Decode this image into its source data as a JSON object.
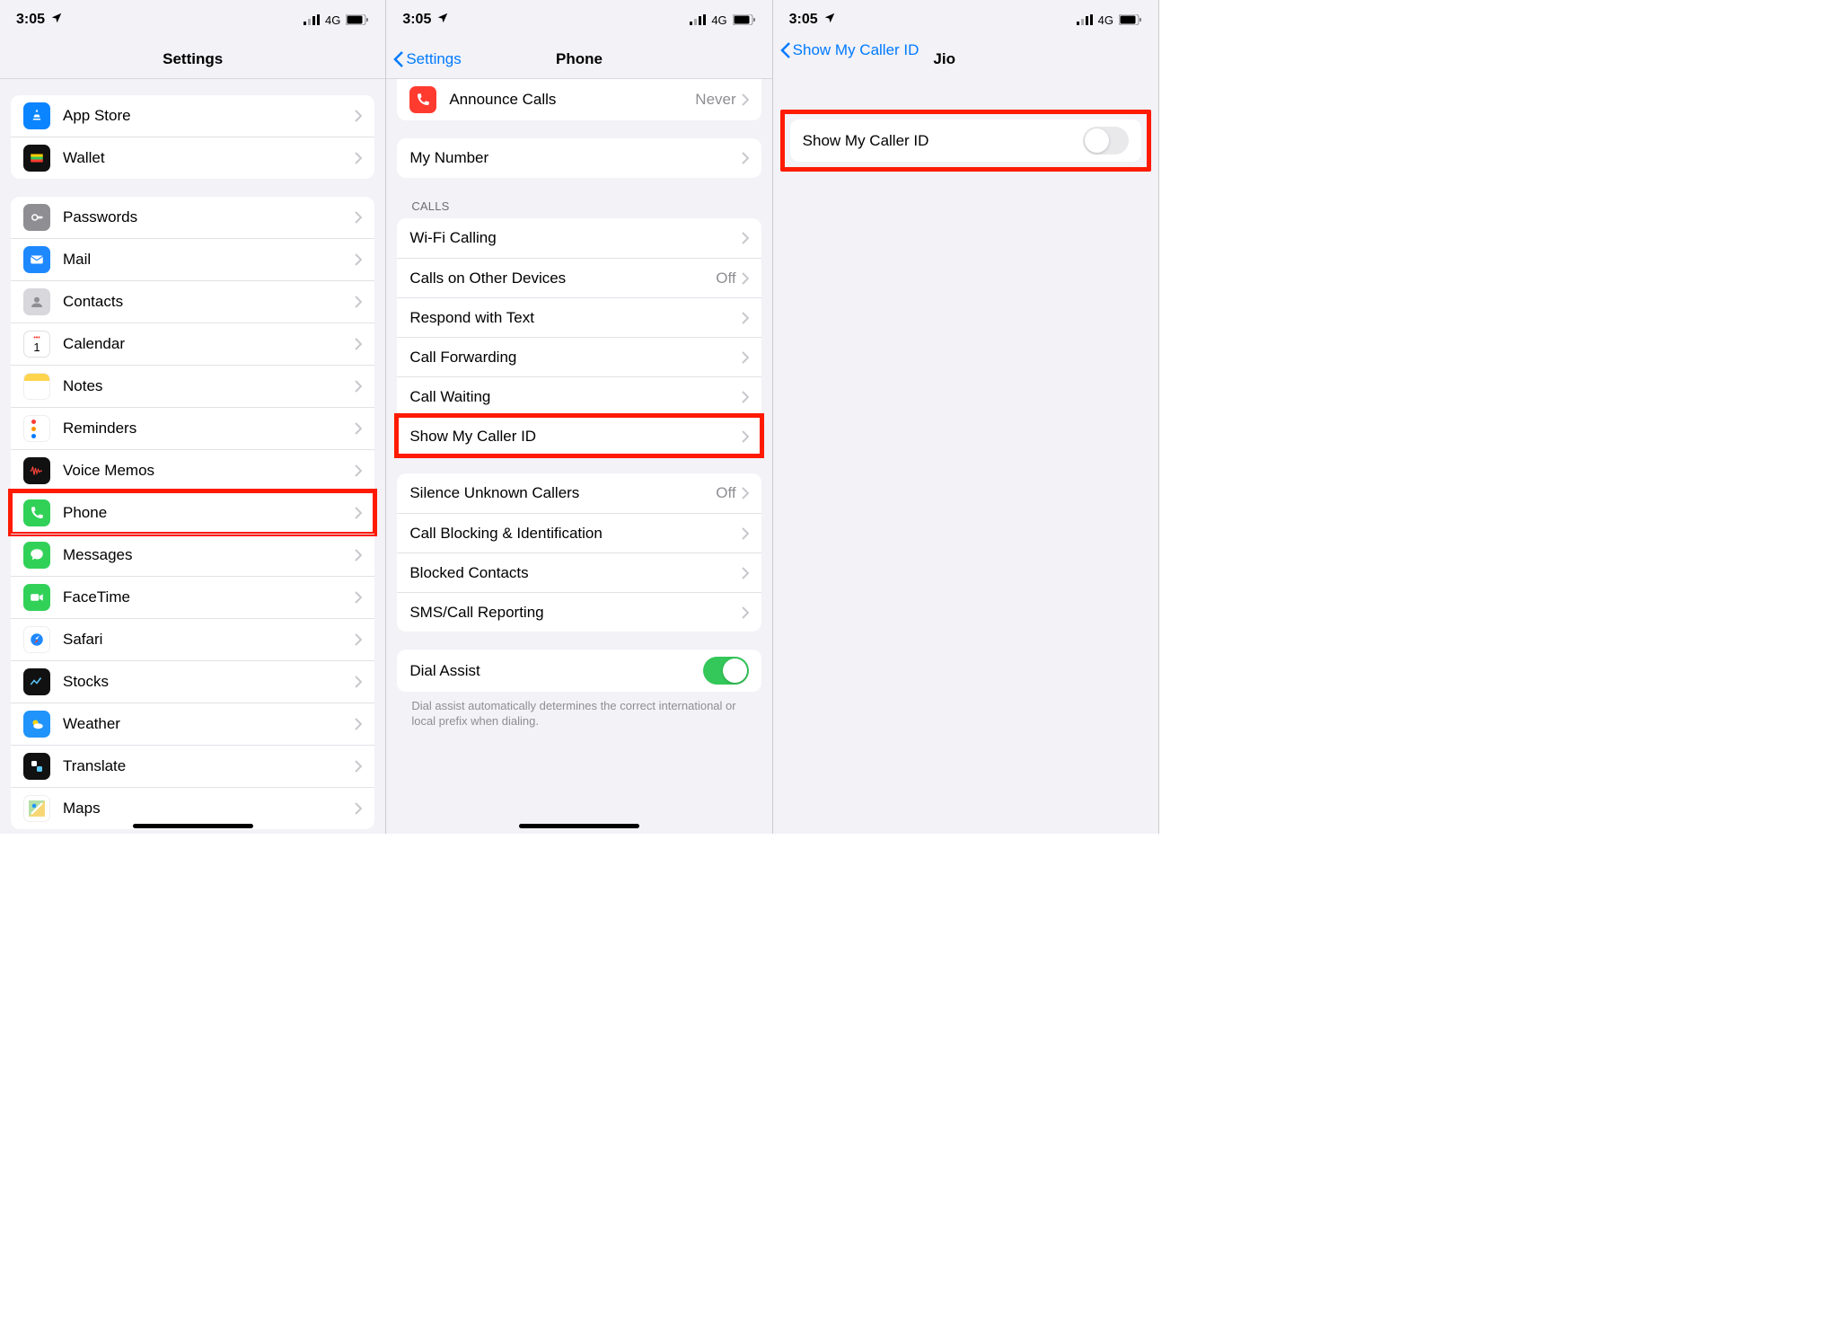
{
  "status": {
    "time": "3:05",
    "network": "4G"
  },
  "screen1": {
    "title": "Settings",
    "group1": [
      {
        "id": "app-store",
        "label": "App Store"
      },
      {
        "id": "wallet",
        "label": "Wallet"
      }
    ],
    "group2": [
      {
        "id": "passwords",
        "label": "Passwords"
      },
      {
        "id": "mail",
        "label": "Mail"
      },
      {
        "id": "contacts",
        "label": "Contacts"
      },
      {
        "id": "calendar",
        "label": "Calendar"
      },
      {
        "id": "notes",
        "label": "Notes"
      },
      {
        "id": "reminders",
        "label": "Reminders"
      },
      {
        "id": "voice-memos",
        "label": "Voice Memos"
      },
      {
        "id": "phone",
        "label": "Phone",
        "highlight": true
      },
      {
        "id": "messages",
        "label": "Messages"
      },
      {
        "id": "facetime",
        "label": "FaceTime"
      },
      {
        "id": "safari",
        "label": "Safari"
      },
      {
        "id": "stocks",
        "label": "Stocks"
      },
      {
        "id": "weather",
        "label": "Weather"
      },
      {
        "id": "translate",
        "label": "Translate"
      },
      {
        "id": "maps",
        "label": "Maps"
      }
    ]
  },
  "screen2": {
    "back": "Settings",
    "title": "Phone",
    "announce": {
      "label": "Announce Calls",
      "value": "Never"
    },
    "mynumber": {
      "label": "My Number"
    },
    "calls_header": "CALLS",
    "calls": [
      {
        "id": "wifi-calling",
        "label": "Wi-Fi Calling"
      },
      {
        "id": "other-devices",
        "label": "Calls on Other Devices",
        "value": "Off"
      },
      {
        "id": "respond-text",
        "label": "Respond with Text"
      },
      {
        "id": "call-forwarding",
        "label": "Call Forwarding"
      },
      {
        "id": "call-waiting",
        "label": "Call Waiting"
      },
      {
        "id": "show-caller-id",
        "label": "Show My Caller ID",
        "highlight": true
      }
    ],
    "group3": [
      {
        "id": "silence-unknown",
        "label": "Silence Unknown Callers",
        "value": "Off"
      },
      {
        "id": "call-blocking",
        "label": "Call Blocking & Identification"
      },
      {
        "id": "blocked-contacts",
        "label": "Blocked Contacts"
      },
      {
        "id": "sms-reporting",
        "label": "SMS/Call Reporting"
      }
    ],
    "dial_assist": {
      "label": "Dial Assist",
      "on": true
    },
    "dial_assist_footer": "Dial assist automatically determines the correct international or local prefix when dialing."
  },
  "screen3": {
    "back": "Show My Caller ID",
    "title": "Jio",
    "row": {
      "label": "Show My Caller ID",
      "on": false
    }
  }
}
